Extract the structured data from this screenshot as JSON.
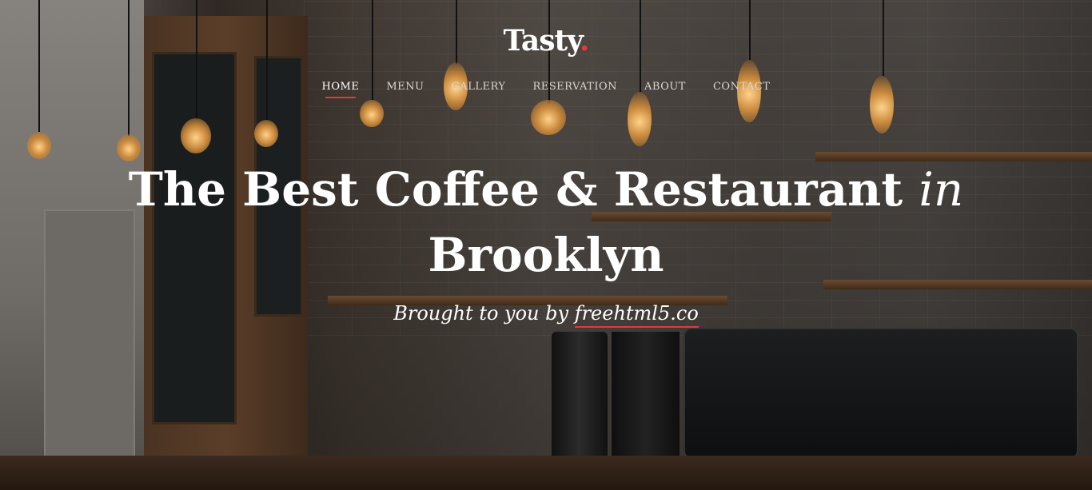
{
  "brand": {
    "name": "Tasty",
    "dot": ".",
    "accent_color": "#e03a3e"
  },
  "nav": {
    "items": [
      {
        "label": "HOME",
        "active": true
      },
      {
        "label": "MENU"
      },
      {
        "label": "GALLERY"
      },
      {
        "label": "RESERVATION"
      },
      {
        "label": "ABOUT"
      },
      {
        "label": "CONTACT"
      }
    ]
  },
  "hero": {
    "headline_main": "The Best Coffee & Restaurant ",
    "headline_in": "in",
    "headline_line2": "Brooklyn",
    "subtitle_prefix": "Brought to you by ",
    "subtitle_link": "freehtml5.co"
  }
}
